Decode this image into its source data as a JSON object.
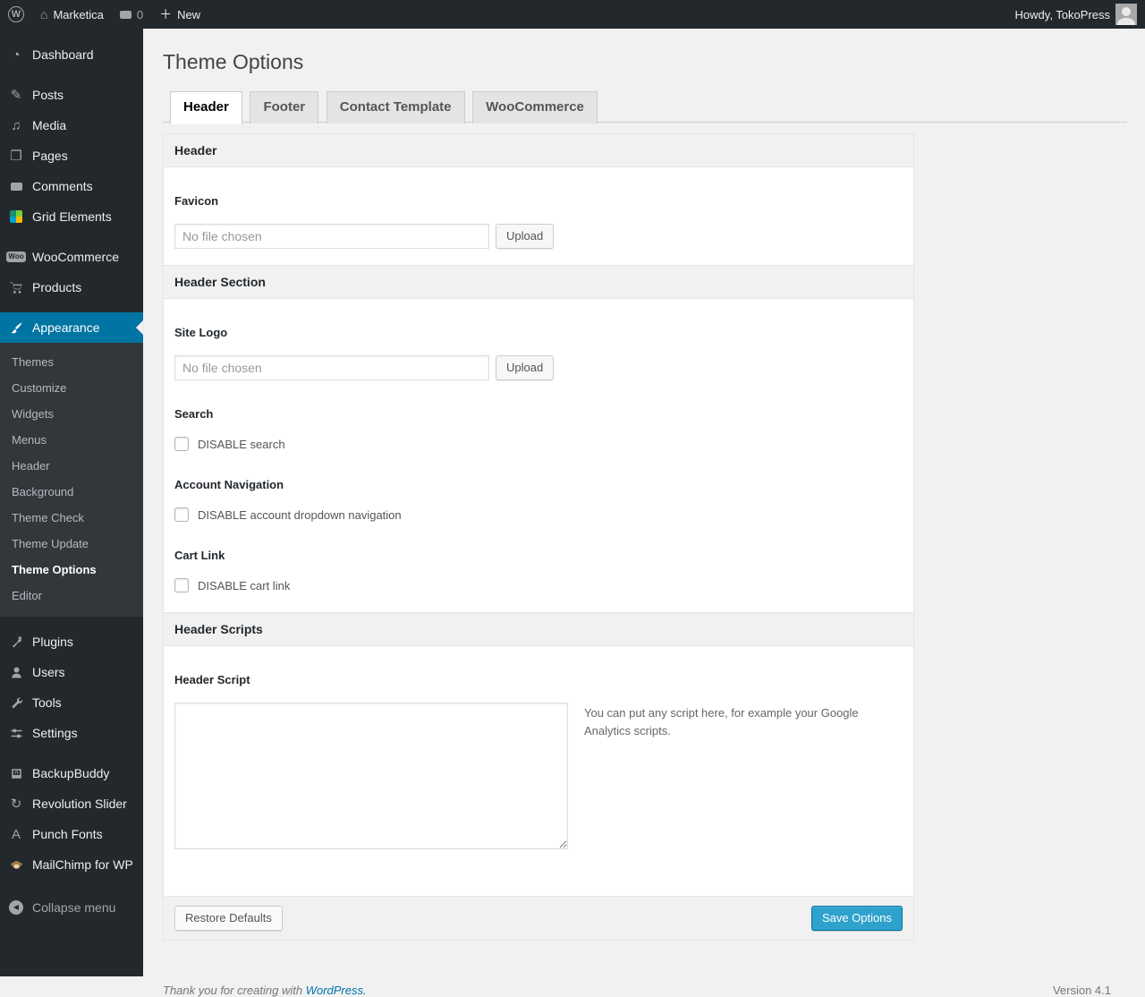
{
  "admin_bar": {
    "site_name": "Marketica",
    "comments_count": "0",
    "new_label": "New",
    "howdy": "Howdy, TokoPress"
  },
  "sidebar": {
    "woo_badge": "Woo",
    "punch_icon_letter": "A",
    "items": [
      {
        "label": "Dashboard",
        "icon": "dashboard-icon"
      },
      {
        "label": "Posts",
        "icon": "pin-icon"
      },
      {
        "label": "Media",
        "icon": "media-icon"
      },
      {
        "label": "Pages",
        "icon": "pages-icon"
      },
      {
        "label": "Comments",
        "icon": "comments-bubble-icon"
      },
      {
        "label": "Grid Elements",
        "icon": "grid-elements-icon"
      },
      {
        "label": "WooCommerce",
        "icon": "woocommerce-badge-icon"
      },
      {
        "label": "Products",
        "icon": "cart-icon"
      },
      {
        "label": "Appearance",
        "icon": "paintbrush-icon",
        "active": true
      },
      {
        "label": "Plugins",
        "icon": "plug-icon"
      },
      {
        "label": "Users",
        "icon": "user-icon"
      },
      {
        "label": "Tools",
        "icon": "tools-icon"
      },
      {
        "label": "Settings",
        "icon": "sliders-icon"
      },
      {
        "label": "BackupBuddy",
        "icon": "backup-disk-icon"
      },
      {
        "label": "Revolution Slider",
        "icon": "refresh-icon"
      },
      {
        "label": "Punch Fonts",
        "icon": "letter-a-icon"
      },
      {
        "label": "MailChimp for WP",
        "icon": "monkey-icon"
      }
    ],
    "appearance_submenu": [
      {
        "label": "Themes"
      },
      {
        "label": "Customize"
      },
      {
        "label": "Widgets"
      },
      {
        "label": "Menus"
      },
      {
        "label": "Header"
      },
      {
        "label": "Background"
      },
      {
        "label": "Theme Check"
      },
      {
        "label": "Theme Update"
      },
      {
        "label": "Theme Options",
        "current": true
      },
      {
        "label": "Editor"
      }
    ],
    "collapse_label": "Collapse menu"
  },
  "main": {
    "page_title": "Theme Options",
    "tabs": [
      {
        "label": "Header",
        "active": true
      },
      {
        "label": "Footer"
      },
      {
        "label": "Contact Template"
      },
      {
        "label": "WooCommerce"
      }
    ],
    "panel": {
      "header_section_title": "Header",
      "favicon": {
        "label": "Favicon",
        "file_value": "No file chosen",
        "upload_label": "Upload"
      },
      "header_area_title": "Header Section",
      "site_logo": {
        "label": "Site Logo",
        "file_value": "No file chosen",
        "upload_label": "Upload"
      },
      "search": {
        "label": "Search",
        "checkbox_label": "DISABLE search",
        "checked": false
      },
      "account_navigation": {
        "label": "Account Navigation",
        "checkbox_label": "DISABLE account dropdown navigation",
        "checked": false
      },
      "cart_link": {
        "label": "Cart Link",
        "checkbox_label": "DISABLE cart link",
        "checked": false
      },
      "header_scripts_title": "Header Scripts",
      "header_script": {
        "label": "Header Script",
        "value": "",
        "help": "You can put any script here, for example your Google Analytics scripts."
      },
      "restore_label": "Restore Defaults",
      "save_label": "Save Options"
    }
  },
  "footer": {
    "thanks_prefix": "Thank you for creating with",
    "wordpress_link": "WordPress.",
    "version": "Version 4.1"
  },
  "colors": {
    "admin_bar_bg": "#23282d",
    "sidebar_bg": "#23282d",
    "submenu_bg": "#32373c",
    "active_menu_bg": "#0074a2",
    "primary_button_bg": "#2ea2cc",
    "link_blue": "#0073aa",
    "page_bg": "#f1f1f1"
  }
}
